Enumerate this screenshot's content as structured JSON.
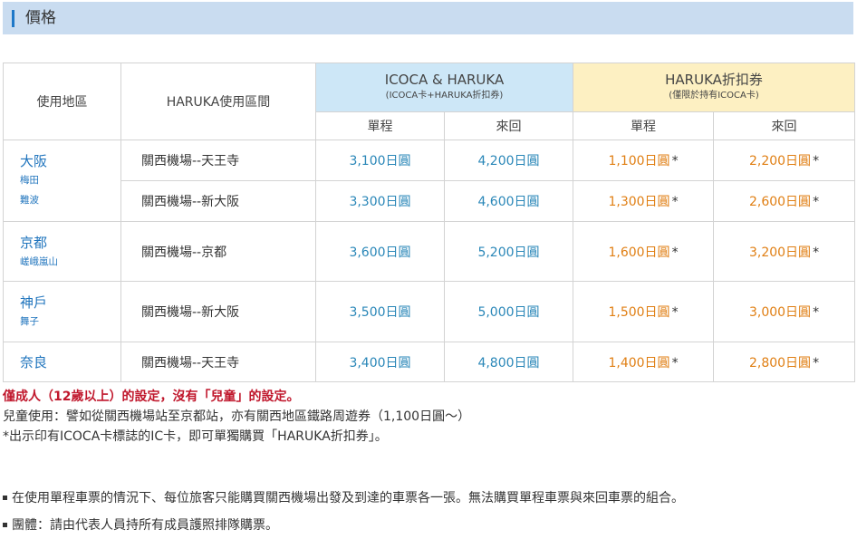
{
  "section": {
    "title": "價格"
  },
  "table": {
    "header": {
      "area": "使用地區",
      "route": "HARUKA使用區間",
      "icoca": {
        "main": "ICOCA & HARUKA",
        "sub": "(ICOCA卡+HARUKA折扣券)"
      },
      "haruka": {
        "main": "HARUKA折扣券",
        "sub": "(僅限於持有ICOCA卡)"
      },
      "single": "單程",
      "round": "來回"
    },
    "groups": [
      {
        "city": "大阪",
        "districts": [
          "梅田",
          "難波"
        ],
        "rows": [
          {
            "route": "關西機場--天王寺",
            "icoca_single": "3,100日圓",
            "icoca_round": "4,200日圓",
            "haruka_single": "1,100日圓",
            "haruka_round": "2,200日圓"
          },
          {
            "route": "關西機場--新大阪",
            "icoca_single": "3,300日圓",
            "icoca_round": "4,600日圓",
            "haruka_single": "1,300日圓",
            "haruka_round": "2,600日圓"
          }
        ]
      },
      {
        "city": "京都",
        "districts": [
          "嵯峨嵐山"
        ],
        "rows": [
          {
            "route": "關西機場--京都",
            "icoca_single": "3,600日圓",
            "icoca_round": "5,200日圓",
            "haruka_single": "1,600日圓",
            "haruka_round": "3,200日圓"
          }
        ]
      },
      {
        "city": "神戶",
        "districts": [
          "舞子"
        ],
        "rows": [
          {
            "route": "關西機場--新大阪",
            "icoca_single": "3,500日圓",
            "icoca_round": "5,000日圓",
            "haruka_single": "1,500日圓",
            "haruka_round": "3,000日圓"
          }
        ]
      },
      {
        "city": "奈良",
        "districts": [],
        "rows": [
          {
            "route": "關西機場--天王寺",
            "icoca_single": "3,400日圓",
            "icoca_round": "4,800日圓",
            "haruka_single": "1,400日圓",
            "haruka_round": "2,800日圓"
          }
        ]
      }
    ],
    "asterisk": "*"
  },
  "notes": {
    "warning": "僅成人（12歲以上）的設定，沒有「兒童」的設定。",
    "child": "兒童使用：譬如從關西機場站至京都站，亦有關西地區鐵路周遊券（1,100日圓～）",
    "ic": "*出示印有ICOCA卡標誌的IC卡，即可單獨購買「HARUKA折扣券」。"
  },
  "bullets": [
    "在使用單程車票的情況下、每位旅客只能購買關西機場出發及到達的車票各一張。無法購買單程車票與來回車票的組合。",
    "團體：請由代表人員持所有成員護照排隊購票。"
  ]
}
